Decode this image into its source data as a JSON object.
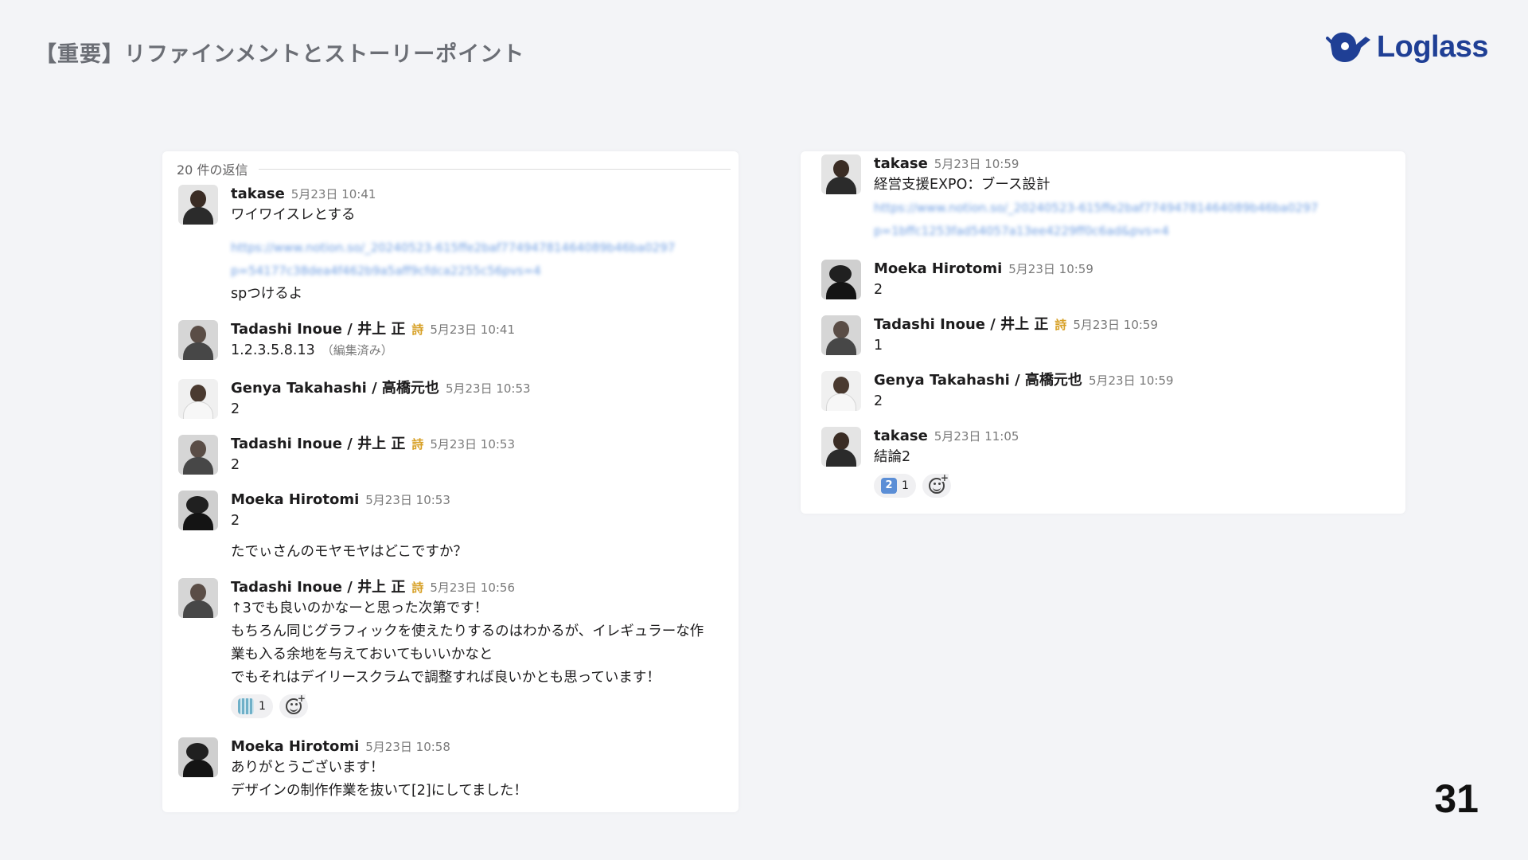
{
  "slide": {
    "title": "【重要】リファインメントとストーリーポイント",
    "logo_text": "Loglass",
    "page_number": "31"
  },
  "left_panel": {
    "replies_label": "20 件の返信",
    "messages": [
      {
        "name": "takase",
        "time": "5月23日 10:41",
        "lines": [
          "ワイワイスレとする"
        ],
        "link": [
          "https://www.notion.so/_20240523-615ffe2baf77494781464089b46ba0297",
          "p=54177c38dea4f462b9a5aff9cfdca2255c56pvs=4"
        ],
        "after": [
          "spつけるよ"
        ]
      },
      {
        "name": "Tadashi Inoue / 井上 正",
        "badge": "詩",
        "time": "5月23日 10:41",
        "lines": [
          "1.2.3.5.8.13"
        ],
        "edited": "（編集済み）"
      },
      {
        "name": "Genya Takahashi / 高橋元也",
        "time": "5月23日 10:53",
        "lines": [
          "2"
        ]
      },
      {
        "name": "Tadashi Inoue / 井上 正",
        "badge": "詩",
        "time": "5月23日 10:53",
        "lines": [
          "2"
        ]
      },
      {
        "name": "Moeka Hirotomi",
        "time": "5月23日 10:53",
        "lines": [
          "2"
        ],
        "after": [
          "たでぃさんのモヤモヤはどこですか？"
        ]
      },
      {
        "name": "Tadashi Inoue / 井上 正",
        "badge": "詩",
        "time": "5月23日 10:56",
        "lines": [
          "↑3でも良いのかなーと思った次第です！",
          "もちろん同じグラフィックを使えたりするのはわかるが、イレギュラーな作",
          "業も入る余地を与えておいてもいいかなと",
          "でもそれはデイリースクラムで調整すれば良いかとも思っています！"
        ],
        "reaction_count": "1"
      },
      {
        "name": "Moeka Hirotomi",
        "time": "5月23日 10:58",
        "lines": [
          "ありがとうございます！",
          "デザインの制作作業を抜いて[2]にしてました！"
        ]
      }
    ]
  },
  "right_panel": {
    "messages": [
      {
        "name": "takase",
        "time": "5月23日 10:59",
        "lines": [
          "経営支援EXPO：ブース設計"
        ],
        "link": [
          "https://www.notion.so/_20240523-615ffe2baf77494781464089b46ba0297",
          "p=1bffc1253fad54057a13ee4229ff0c6ad&pvs=4"
        ]
      },
      {
        "name": "Moeka Hirotomi",
        "time": "5月23日 10:59",
        "lines": [
          "2"
        ]
      },
      {
        "name": "Tadashi Inoue / 井上 正",
        "badge": "詩",
        "time": "5月23日 10:59",
        "lines": [
          "1"
        ]
      },
      {
        "name": "Genya Takahashi / 高橋元也",
        "time": "5月23日 10:59",
        "lines": [
          "2"
        ]
      },
      {
        "name": "takase",
        "time": "5月23日 11:05",
        "lines": [
          "結論2"
        ],
        "reaction_emoji": "2",
        "reaction_count": "1"
      }
    ]
  },
  "colors": {
    "background": "#f3f4f7",
    "logo": "#1f3f95",
    "badge": "#d7a026"
  },
  "icons": [
    "whale-logo-icon",
    "add-reaction-icon"
  ]
}
